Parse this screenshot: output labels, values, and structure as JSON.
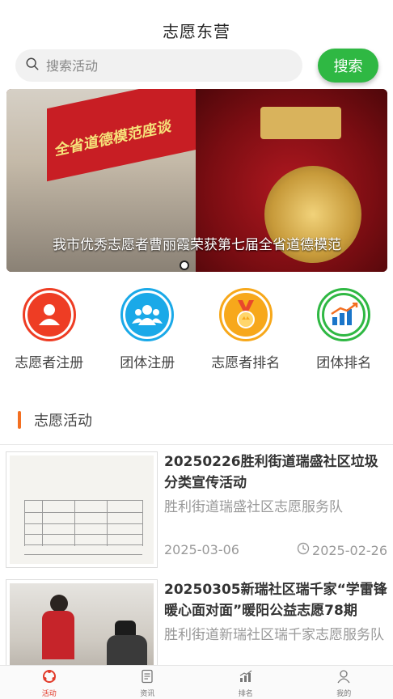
{
  "header": {
    "title": "志愿东营"
  },
  "search": {
    "placeholder": "搜索活动",
    "button_label": "搜索"
  },
  "banner": {
    "caption": "我市优秀志愿者曹丽霞荣获第七届全省道德模范",
    "sign_text": "全省道德模范座谈"
  },
  "quick_links": [
    {
      "label": "志愿者注册",
      "color": "#ee3d24",
      "icon": "person-icon"
    },
    {
      "label": "团体注册",
      "color": "#1aa9e8",
      "icon": "group-icon"
    },
    {
      "label": "志愿者排名",
      "color": "#f7a81b",
      "icon": "medal-icon"
    },
    {
      "label": "团体排名",
      "color": "#2fb843",
      "icon": "bar-chart-icon"
    }
  ],
  "section": {
    "title": "志愿活动"
  },
  "activities": [
    {
      "title": "20250226胜利街道瑞盛社区垃圾分类宣传活动",
      "org": "胜利街道瑞盛社区志愿服务队",
      "start_date": "2025-03-06",
      "publish_date": "2025-02-26"
    },
    {
      "title": "20250305新瑞社区瑞千家“学雷锋暖心面对面”暖阳公益志愿78期",
      "org": "胜利街道新瑞社区瑞千家志愿服务队"
    }
  ],
  "tabbar": [
    {
      "label": "活动",
      "icon": "activity-icon",
      "active": true
    },
    {
      "label": "资讯",
      "icon": "news-icon",
      "active": false
    },
    {
      "label": "排名",
      "icon": "ranking-icon",
      "active": false
    },
    {
      "label": "我的",
      "icon": "profile-icon",
      "active": false
    }
  ],
  "colors": {
    "accent_green": "#2fb843",
    "section_bar": "#f36f21",
    "tab_active": "#e23b2a"
  }
}
